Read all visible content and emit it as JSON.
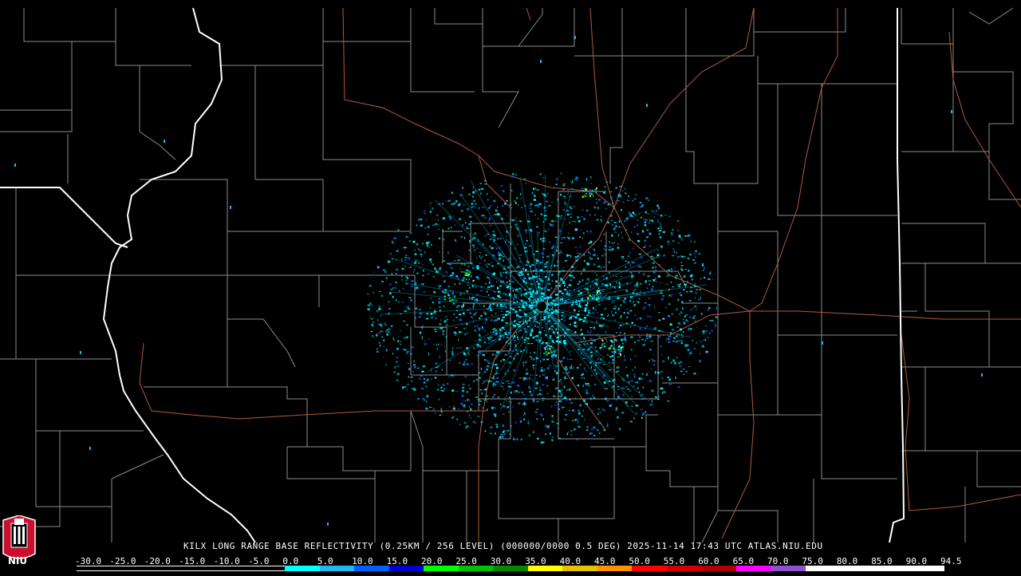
{
  "caption": "KILX LONG RANGE BASE REFLECTIVITY (0.25KM / 256 LEVEL) (000000/0000 0.5 DEG) 2025-11-14 17:43 UTC  ATLAS.NIU.EDU",
  "logo": {
    "text": "NIU",
    "icon": "university-tower-logo",
    "color": "#c8102e"
  },
  "colors": {
    "background": "#000000",
    "county_lines": "#8c8c8c",
    "state_lines": "#ffffff",
    "roads": "#b05a3a"
  },
  "scale": {
    "labels": [
      "-30.0",
      "-25.0",
      "-20.0",
      "-15.0",
      "-10.0",
      "-5.0",
      "0.0",
      "5.0",
      "10.0",
      "15.0",
      "20.0",
      "25.0",
      "30.0",
      "35.0",
      "40.0",
      "45.0",
      "50.0",
      "55.0",
      "60.0",
      "65.0",
      "70.0",
      "75.0",
      "80.0",
      "85.0",
      "90.0",
      "94.5"
    ],
    "colors": [
      "#000000",
      "#000000",
      "#000000",
      "#000000",
      "#000000",
      "#000000",
      "#00ffff",
      "#20b8f0",
      "#0060ff",
      "#0000d0",
      "#00ff00",
      "#00c000",
      "#008800",
      "#ffff00",
      "#e8c000",
      "#ff9000",
      "#ff0000",
      "#d00000",
      "#b00000",
      "#ff00ff",
      "#9050d0",
      "#ffffff",
      "#ffffff",
      "#ffffff",
      "#ffffff"
    ]
  },
  "radar": {
    "site": "KILX"
  }
}
